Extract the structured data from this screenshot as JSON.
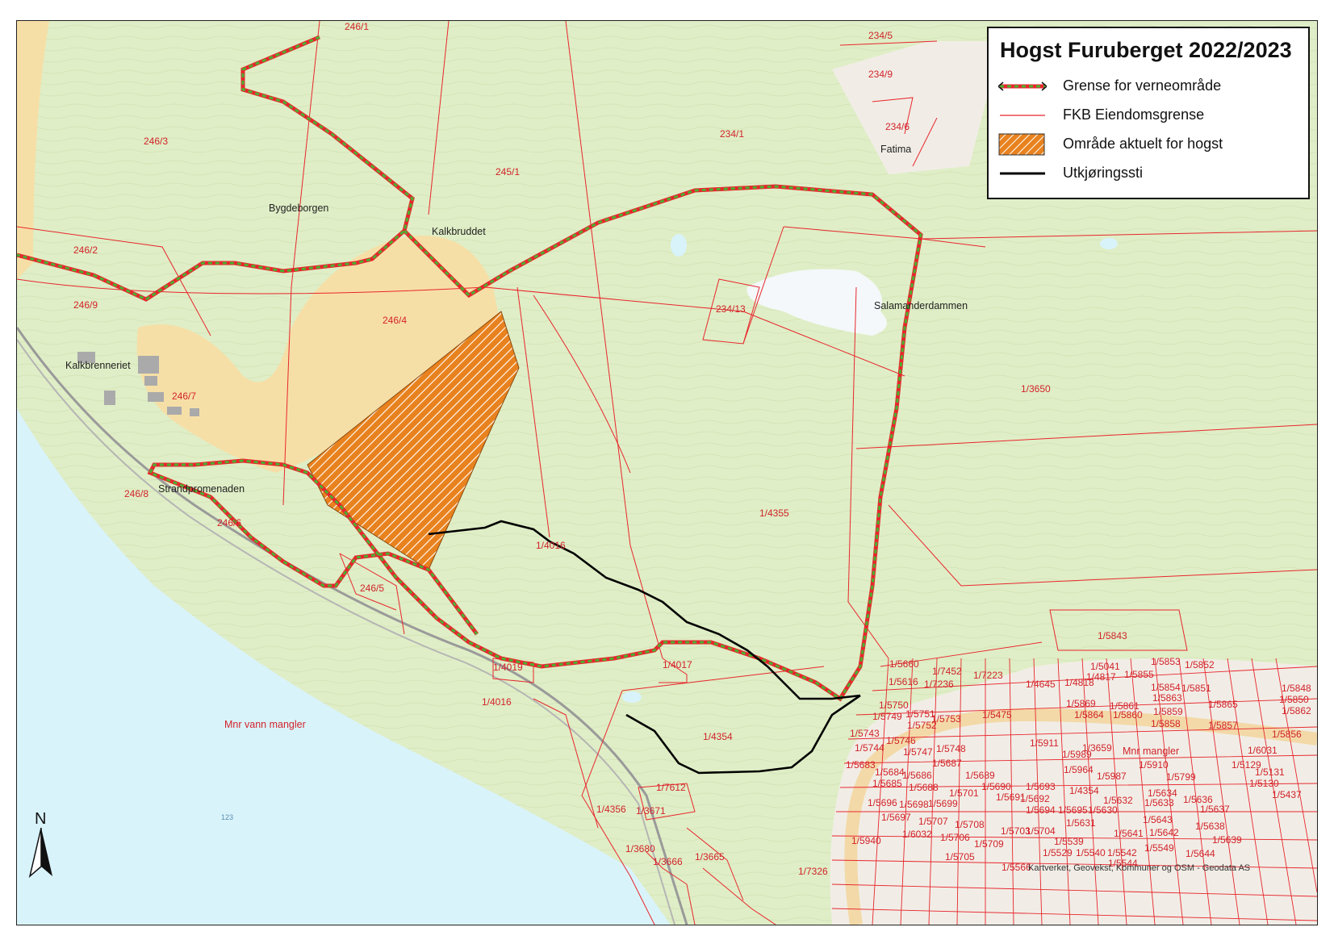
{
  "legend": {
    "title": "Hogst Furuberget 2022/2023",
    "items": [
      {
        "label": "Grense for verneområde",
        "icon": "dashed-green-boundary-icon"
      },
      {
        "label": "FKB Eiendomsgrense",
        "icon": "red-line-icon"
      },
      {
        "label": "Område aktuelt for hogst",
        "icon": "orange-hatch-icon"
      },
      {
        "label": "Utkjøringssti",
        "icon": "black-line-icon"
      }
    ]
  },
  "place_names": {
    "bygdeborgen": "Bygdeborgen",
    "kalkbruddet": "Kalkbruddet",
    "kalkbrenneriet": "Kalkbrenneriet",
    "strandpromenaden": "Strandpromenaden",
    "salamanderdammen": "Salamanderdammen",
    "fatima": "Fatima",
    "mnr_vann": "Mnr vann mangler",
    "mnr_mangler": "Mnr mangler",
    "elev_123": "123"
  },
  "parcels": [
    "246/1",
    "234/5",
    "234/9",
    "234/6",
    "246/3",
    "245/1",
    "234/1",
    "246/2",
    "246/9",
    "234/13",
    "246/4",
    "246/7",
    "1/3650",
    "246/8",
    "246/6",
    "1/4355",
    "1/4016",
    "246/5",
    "1/5843",
    "1/4019",
    "1/4017",
    "1/5660",
    "1/7452",
    "1/7223",
    "1/4645",
    "1/4818",
    "1/5616",
    "1/7236",
    "1/5750",
    "1/5751",
    "1/5749",
    "1/5752",
    "1/5753",
    "1/5475",
    "1/4354",
    "1/5743",
    "1/5744",
    "1/5746",
    "1/5747",
    "1/5748",
    "1/5911",
    "1/3659",
    "1/5683",
    "1/5684",
    "1/5685",
    "1/5686",
    "1/5688",
    "1/5687",
    "1/5689",
    "1/5690",
    "1/5693",
    "1/5696",
    "1/5698",
    "1/5699",
    "1/5701",
    "1/5697",
    "1/5707",
    "1/5708",
    "1/6032",
    "1/5706",
    "1/5940",
    "1/5705",
    "1/5709",
    "1/5703",
    "1/5704",
    "1/5529",
    "1/5540",
    "1/5542",
    "1/5544",
    "1/5549",
    "1/5539",
    "1/5631",
    "1/5630",
    "1/5632",
    "1/5633",
    "1/5634",
    "1/5636",
    "1/5637",
    "1/5638",
    "1/5639",
    "1/5641",
    "1/5642",
    "1/5643",
    "1/5644",
    "1/5695",
    "1/5694",
    "1/5691",
    "1/5692",
    "1/5989",
    "1/5987",
    "1/5964",
    "1/5910",
    "1/5799",
    "1/5129",
    "1/5131",
    "1/5130",
    "1/5437",
    "1/6031",
    "1/5856",
    "1/5857",
    "1/5858",
    "1/5859",
    "1/5860",
    "1/5861",
    "1/5862",
    "1/5863",
    "1/5864",
    "1/5865",
    "1/5869",
    "1/5855",
    "1/5853",
    "1/5852",
    "1/5851",
    "1/5854",
    "1/5848",
    "1/5850",
    "1/5041",
    "1/4817",
    "1/7612",
    "1/3671",
    "1/4356",
    "1/3680",
    "1/3666",
    "1/3665",
    "1/7326",
    "1/5566"
  ],
  "parcel_labels": {
    "p246_1": "246/1",
    "p234_5": "234/5",
    "p234_9": "234/9",
    "p234_6": "234/6",
    "p246_3": "246/3",
    "p245_1": "245/1",
    "p234_1": "234/1",
    "p246_2": "246/2",
    "p246_9": "246/9",
    "p234_13": "234/13",
    "p246_4": "246/4",
    "p246_7": "246/7",
    "p1_3650": "1/3650",
    "p246_8": "246/8",
    "p246_6": "246/6",
    "p1_4355": "1/4355",
    "p1_4016a": "1/4016",
    "p246_5": "246/5",
    "p1_5843": "1/5843",
    "p1_4019": "1/4019",
    "p1_4017": "1/4017",
    "p1_4016b": "1/4016",
    "p1_4354": "1/4354",
    "p1_7612": "1/7612",
    "p1_3671": "1/3671",
    "p1_4356": "1/4356",
    "p1_3680": "1/3680",
    "p1_3666": "1/3666",
    "p1_3665": "1/3665",
    "p1_7326": "1/7326",
    "p1_5660": "1/5660",
    "p1_7452": "1/7452",
    "p1_7223": "1/7223",
    "p1_4645": "1/4645",
    "p1_4818": "1/4818",
    "p1_5616": "1/5616",
    "p1_7236": "1/7236",
    "p1_5750": "1/5750",
    "p1_5751": "1/5751",
    "p1_5749": "1/5749",
    "p1_5752": "1/5752",
    "p1_5753": "1/5753",
    "p1_5475": "1/5475",
    "p1_5743": "1/5743",
    "p1_5744": "1/5744",
    "p1_5746": "1/5746",
    "p1_5747": "1/5747",
    "p1_5748": "1/5748",
    "p1_5911": "1/5911",
    "p1_3659": "1/3659",
    "p1_5683": "1/5683",
    "p1_5684": "1/5684",
    "p1_5685": "1/5685",
    "p1_5686": "1/5686",
    "p1_5688": "1/5688",
    "p1_5687": "1/5687",
    "p1_5689": "1/5689",
    "p1_5690": "1/5690",
    "p1_5693": "1/5693",
    "p1_4354b": "1/4354",
    "p1_5696": "1/5696",
    "p1_5698": "1/5698",
    "p1_5699": "1/5699",
    "p1_5701": "1/5701",
    "p1_5697": "1/5697",
    "p1_5707": "1/5707",
    "p1_5708": "1/5708",
    "p1_6032": "1/6032",
    "p1_5706": "1/5706",
    "p1_5940": "1/5940",
    "p1_5705": "1/5705",
    "p1_5709": "1/5709",
    "p1_5703": "1/5703",
    "p1_5704": "1/5704",
    "p1_5529": "1/5529",
    "p1_5540": "1/5540",
    "p1_5542": "1/5542",
    "p1_5544": "1/5544",
    "p1_5549": "1/5549",
    "p1_5539": "1/5539",
    "p1_5631": "1/5631",
    "p1_5630": "1/5630",
    "p1_5632": "1/5632",
    "p1_5633": "1/5633",
    "p1_5634": "1/5634",
    "p1_5636": "1/5636",
    "p1_5637": "1/5637",
    "p1_5638": "1/5638",
    "p1_5639": "1/5639",
    "p1_5641": "1/5641",
    "p1_5642": "1/5642",
    "p1_5643": "1/5643",
    "p1_5644": "1/5644",
    "p1_5695": "1/5695",
    "p1_5694": "1/5694",
    "p1_5691": "1/5691",
    "p1_5692": "1/5692",
    "p1_5987": "1/5987",
    "p1_5989": "1/5989",
    "p1_5964": "1/5964",
    "p1_5910": "1/5910",
    "p1_5799": "1/5799",
    "p1_5129": "1/5129",
    "p1_5131": "1/5131",
    "p1_5130": "1/5130",
    "p1_5437": "1/5437",
    "p1_6031": "1/6031",
    "p1_5856": "1/5856",
    "p1_5857": "1/5857",
    "p1_5858": "1/5858",
    "p1_5859": "1/5859",
    "p1_5860": "1/5860",
    "p1_5861": "1/5861",
    "p1_5862": "1/5862",
    "p1_5863": "1/5863",
    "p1_5864": "1/5864",
    "p1_5865": "1/5865",
    "p1_5869": "1/5869",
    "p1_5855": "1/5855",
    "p1_5853": "1/5853",
    "p1_5852": "1/5852",
    "p1_5851": "1/5851",
    "p1_5854": "1/5854",
    "p1_5848": "1/5848",
    "p1_5850": "1/5850",
    "p1_5041": "1/5041",
    "p1_4817": "1/4817",
    "p1_5566": "1/5566"
  },
  "attribution": "Kartverket, Geovekst, Kommuner og OSM - Geodata AS",
  "north_arrow": {
    "letter": "N",
    "icon": "north-arrow-icon"
  },
  "colors": {
    "forest": "#dfeec6",
    "water": "#d9f3fb",
    "quarry": "#f6dfa7",
    "parcel_line": "#e8262d",
    "boundary_green": "#4caf2f",
    "hatch_orange": "#e8821e",
    "trail": "#000000",
    "urban": "#f1ede6"
  }
}
